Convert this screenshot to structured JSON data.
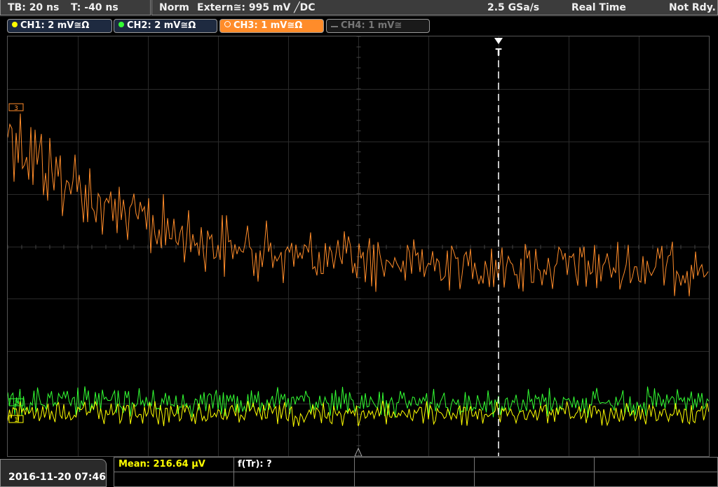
{
  "status_bar": {
    "timebase": "TB: 20 ns",
    "trigger_offset": "T: -40 ns",
    "trigger_mode": "Norm",
    "trigger_source": "Extern≅: 995 mV ╱DC",
    "sample_rate": "2.5 GSa/s",
    "acq_mode": "Real Time",
    "state": "Not Rdy."
  },
  "channels": [
    {
      "label": "CH1: 2 mV≅Ω",
      "color": "#ffff00",
      "active": true
    },
    {
      "label": "CH2: 2 mV≅Ω",
      "color": "#33ff33",
      "active": true
    },
    {
      "label": "CH3: 1 mV≅Ω",
      "color": "#ff8c2a",
      "active": true
    },
    {
      "label": "CH4: 1 mV≅",
      "color": "#8a8a8a",
      "active": false
    }
  ],
  "markers": {
    "trigger": "T",
    "ch3": "3",
    "ch2": "2",
    "ch1": "1"
  },
  "measurement": {
    "mean": "Mean: 216.64 µV",
    "rise": "f(Tr): ?"
  },
  "datetime": "2016-11-20 07:46"
}
